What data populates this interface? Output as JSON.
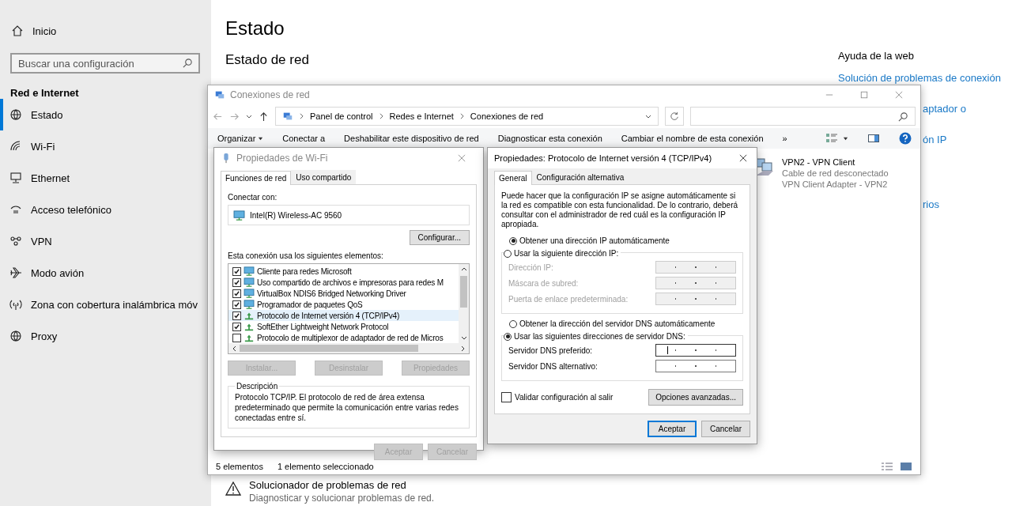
{
  "sidebar": {
    "home": "Inicio",
    "search": {
      "placeholder": "Buscar una configuración"
    },
    "section": "Red e Internet",
    "items": [
      {
        "label": "Estado",
        "selected": true
      },
      {
        "label": "Wi-Fi",
        "selected": false
      },
      {
        "label": "Ethernet",
        "selected": false
      },
      {
        "label": "Acceso telefónico",
        "selected": false
      },
      {
        "label": "VPN",
        "selected": false
      },
      {
        "label": "Modo avión",
        "selected": false
      },
      {
        "label": "Zona con cobertura inalámbrica móv",
        "selected": false
      },
      {
        "label": "Proxy",
        "selected": false
      }
    ]
  },
  "main": {
    "title": "Estado",
    "subtitle": "Estado de red",
    "troubleshooter": {
      "title": "Solucionador de problemas de red",
      "description": "Diagnosticar y solucionar problemas de red."
    }
  },
  "help": {
    "title": "Ayuda de la web",
    "links": [
      "Solución de problemas de conexión",
      "aptador o",
      "ón IP",
      "rios"
    ]
  },
  "explorer": {
    "title": "Conexiones de red",
    "breadcrumb": [
      "Panel de control",
      "Redes e Internet",
      "Conexiones de red"
    ],
    "toolbar": [
      {
        "label": "Organizar",
        "menu": true
      },
      {
        "label": "Conectar a",
        "menu": false
      },
      {
        "label": "Deshabilitar este dispositivo de red",
        "menu": false
      },
      {
        "label": "Diagnosticar esta conexión",
        "menu": false
      },
      {
        "label": "Cambiar el nombre de esta conexión",
        "menu": false
      },
      {
        "label": "»",
        "menu": false
      }
    ],
    "connections": [
      {
        "name": "VPN2 - VPN Client",
        "status": "Cable de red desconectado",
        "adapter": "VPN Client Adapter - VPN2"
      }
    ],
    "status_bar": {
      "count": "5 elementos",
      "selection": "1 elemento seleccionado"
    }
  },
  "wifi_dialog": {
    "title": "Propiedades de Wi-Fi",
    "tabs": [
      {
        "label": "Funciones de red",
        "selected": true
      },
      {
        "label": "Uso compartido",
        "selected": false
      }
    ],
    "connect_label": "Conectar con:",
    "adapter": "Intel(R) Wireless-AC 9560",
    "configure_button": "Configurar...",
    "items_label": "Esta conexión usa los siguientes elementos:",
    "components": [
      {
        "label": "Cliente para redes Microsoft",
        "checked": true,
        "selected": false,
        "kind": "client"
      },
      {
        "label": "Uso compartido de archivos e impresoras para redes M",
        "checked": true,
        "selected": false,
        "kind": "client"
      },
      {
        "label": "VirtualBox NDIS6 Bridged Networking Driver",
        "checked": true,
        "selected": false,
        "kind": "client"
      },
      {
        "label": "Programador de paquetes QoS",
        "checked": true,
        "selected": false,
        "kind": "client"
      },
      {
        "label": "Protocolo de Internet versión 4 (TCP/IPv4)",
        "checked": true,
        "selected": true,
        "kind": "protocol"
      },
      {
        "label": "SoftEther Lightweight Network Protocol",
        "checked": true,
        "selected": false,
        "kind": "protocol"
      },
      {
        "label": "Protocolo de multiplexor de adaptador de red de Micros",
        "checked": false,
        "selected": false,
        "kind": "protocol"
      }
    ],
    "actions": [
      {
        "label": "Instalar...",
        "disabled": true
      },
      {
        "label": "Desinstalar",
        "disabled": true
      },
      {
        "label": "Propiedades",
        "disabled": true
      }
    ],
    "description_title": "Descripción",
    "description": "Protocolo TCP/IP. El protocolo de red de área extensa predeterminado que permite la comunicación entre varias redes conectadas entre sí.",
    "buttons": [
      {
        "label": "Aceptar",
        "disabled": true
      },
      {
        "label": "Cancelar",
        "disabled": true
      }
    ]
  },
  "ipv4_dialog": {
    "title": "Propiedades: Protocolo de Internet versión 4 (TCP/IPv4)",
    "tabs": [
      {
        "label": "General",
        "selected": true
      },
      {
        "label": "Configuración alternativa",
        "selected": false
      }
    ],
    "intro": "Puede hacer que la configuración IP se asigne automáticamente si la red es compatible con esta funcionalidad. De lo contrario, deberá consultar con el administrador de red cuál es la configuración IP apropiada.",
    "ip_options": [
      {
        "label": "Obtener una dirección IP automáticamente",
        "selected": true
      },
      {
        "label": "Usar la siguiente dirección IP:",
        "selected": false
      }
    ],
    "ip_fields": [
      {
        "label": "Dirección IP:",
        "disabled": true,
        "focused": false
      },
      {
        "label": "Máscara de subred:",
        "disabled": true,
        "focused": false
      },
      {
        "label": "Puerta de enlace predeterminada:",
        "disabled": true,
        "focused": false
      }
    ],
    "dns_options": [
      {
        "label": "Obtener la dirección del servidor DNS automáticamente",
        "selected": false
      },
      {
        "label": "Usar las siguientes direcciones de servidor DNS:",
        "selected": true
      }
    ],
    "dns_fields": [
      {
        "label": "Servidor DNS preferido:",
        "disabled": false,
        "focused": true
      },
      {
        "label": "Servidor DNS alternativo:",
        "disabled": false,
        "focused": false
      }
    ],
    "validate": {
      "label": "Validar configuración al salir",
      "checked": false
    },
    "advanced_button": "Opciones avanzadas...",
    "buttons": [
      {
        "label": "Aceptar",
        "focused": true
      },
      {
        "label": "Cancelar",
        "focused": false
      }
    ]
  }
}
